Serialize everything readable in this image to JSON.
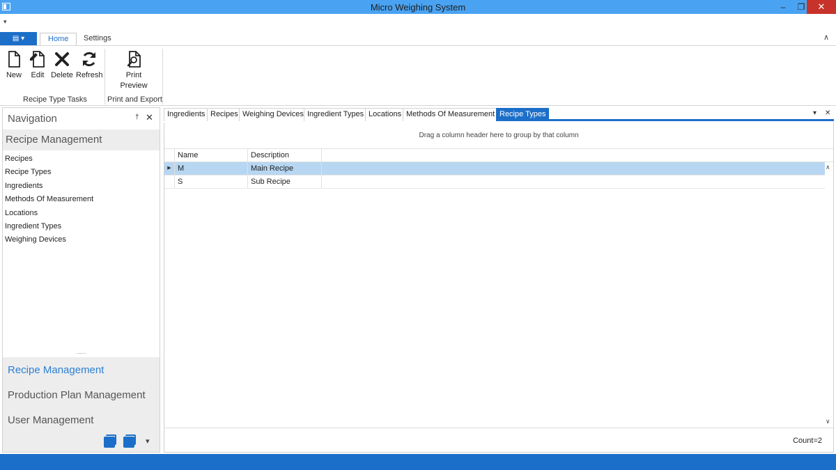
{
  "window": {
    "title": "Micro Weighing System",
    "minimize_glyph": "–",
    "maximize_glyph": "❐",
    "close_glyph": "✕"
  },
  "qat": {
    "glyph": "▾"
  },
  "ribbon": {
    "app_menu_glyph": "▤ ▾",
    "tabs": [
      {
        "label": "Home",
        "active": true
      },
      {
        "label": "Settings",
        "active": false
      }
    ],
    "collapse_glyph": "∧",
    "groups": [
      {
        "label": "Recipe Type Tasks",
        "buttons": [
          {
            "label": "New",
            "icon": "new-document-icon"
          },
          {
            "label": "Edit",
            "icon": "edit-document-icon"
          },
          {
            "label": "Delete",
            "icon": "delete-icon"
          },
          {
            "label": "Refresh",
            "icon": "refresh-icon"
          }
        ]
      },
      {
        "label": "Print and Export",
        "buttons": [
          {
            "label": "Print",
            "label2": "Preview",
            "icon": "print-preview-icon"
          }
        ]
      }
    ]
  },
  "navigation": {
    "title": "Navigation",
    "pin_glyph": "†",
    "close_glyph": "✕",
    "active_group": "Recipe Management",
    "items": [
      "Recipes",
      "Recipe Types",
      "Ingredients",
      "Methods Of Measurement",
      "Locations",
      "Ingredient Types",
      "Weighing Devices"
    ],
    "splitter": "......",
    "groups": [
      {
        "label": "Recipe Management",
        "active": true
      },
      {
        "label": "Production Plan Management",
        "active": false
      },
      {
        "label": "User Management",
        "active": false
      }
    ],
    "more_glyph": "▾"
  },
  "document": {
    "tabs": [
      {
        "label": "Ingredients",
        "active": false
      },
      {
        "label": "Recipes",
        "active": false
      },
      {
        "label": "Weighing Devices",
        "active": false
      },
      {
        "label": "Ingredient Types",
        "active": false
      },
      {
        "label": "Locations",
        "active": false
      },
      {
        "label": "Methods Of Measurement",
        "active": false
      },
      {
        "label": "Recipe Types",
        "active": true
      }
    ],
    "menu_glyph": "▾",
    "close_glyph": "✕",
    "grid": {
      "group_panel_text": "Drag a column header here to group by that column",
      "columns": [
        "Name",
        "Description"
      ],
      "rows": [
        {
          "name": "M",
          "description": "Main Recipe",
          "selected": true
        },
        {
          "name": "S",
          "description": "Sub Recipe",
          "selected": false
        }
      ],
      "row_indicator_glyph": "▶",
      "scroll_up_glyph": "∧",
      "scroll_down_glyph": "∨",
      "footer": "Count=2"
    }
  },
  "colors": {
    "titlebar": "#4aa3f2",
    "accent": "#1c6fc9",
    "close": "#c7332a",
    "selection": "#b7d6f1"
  }
}
